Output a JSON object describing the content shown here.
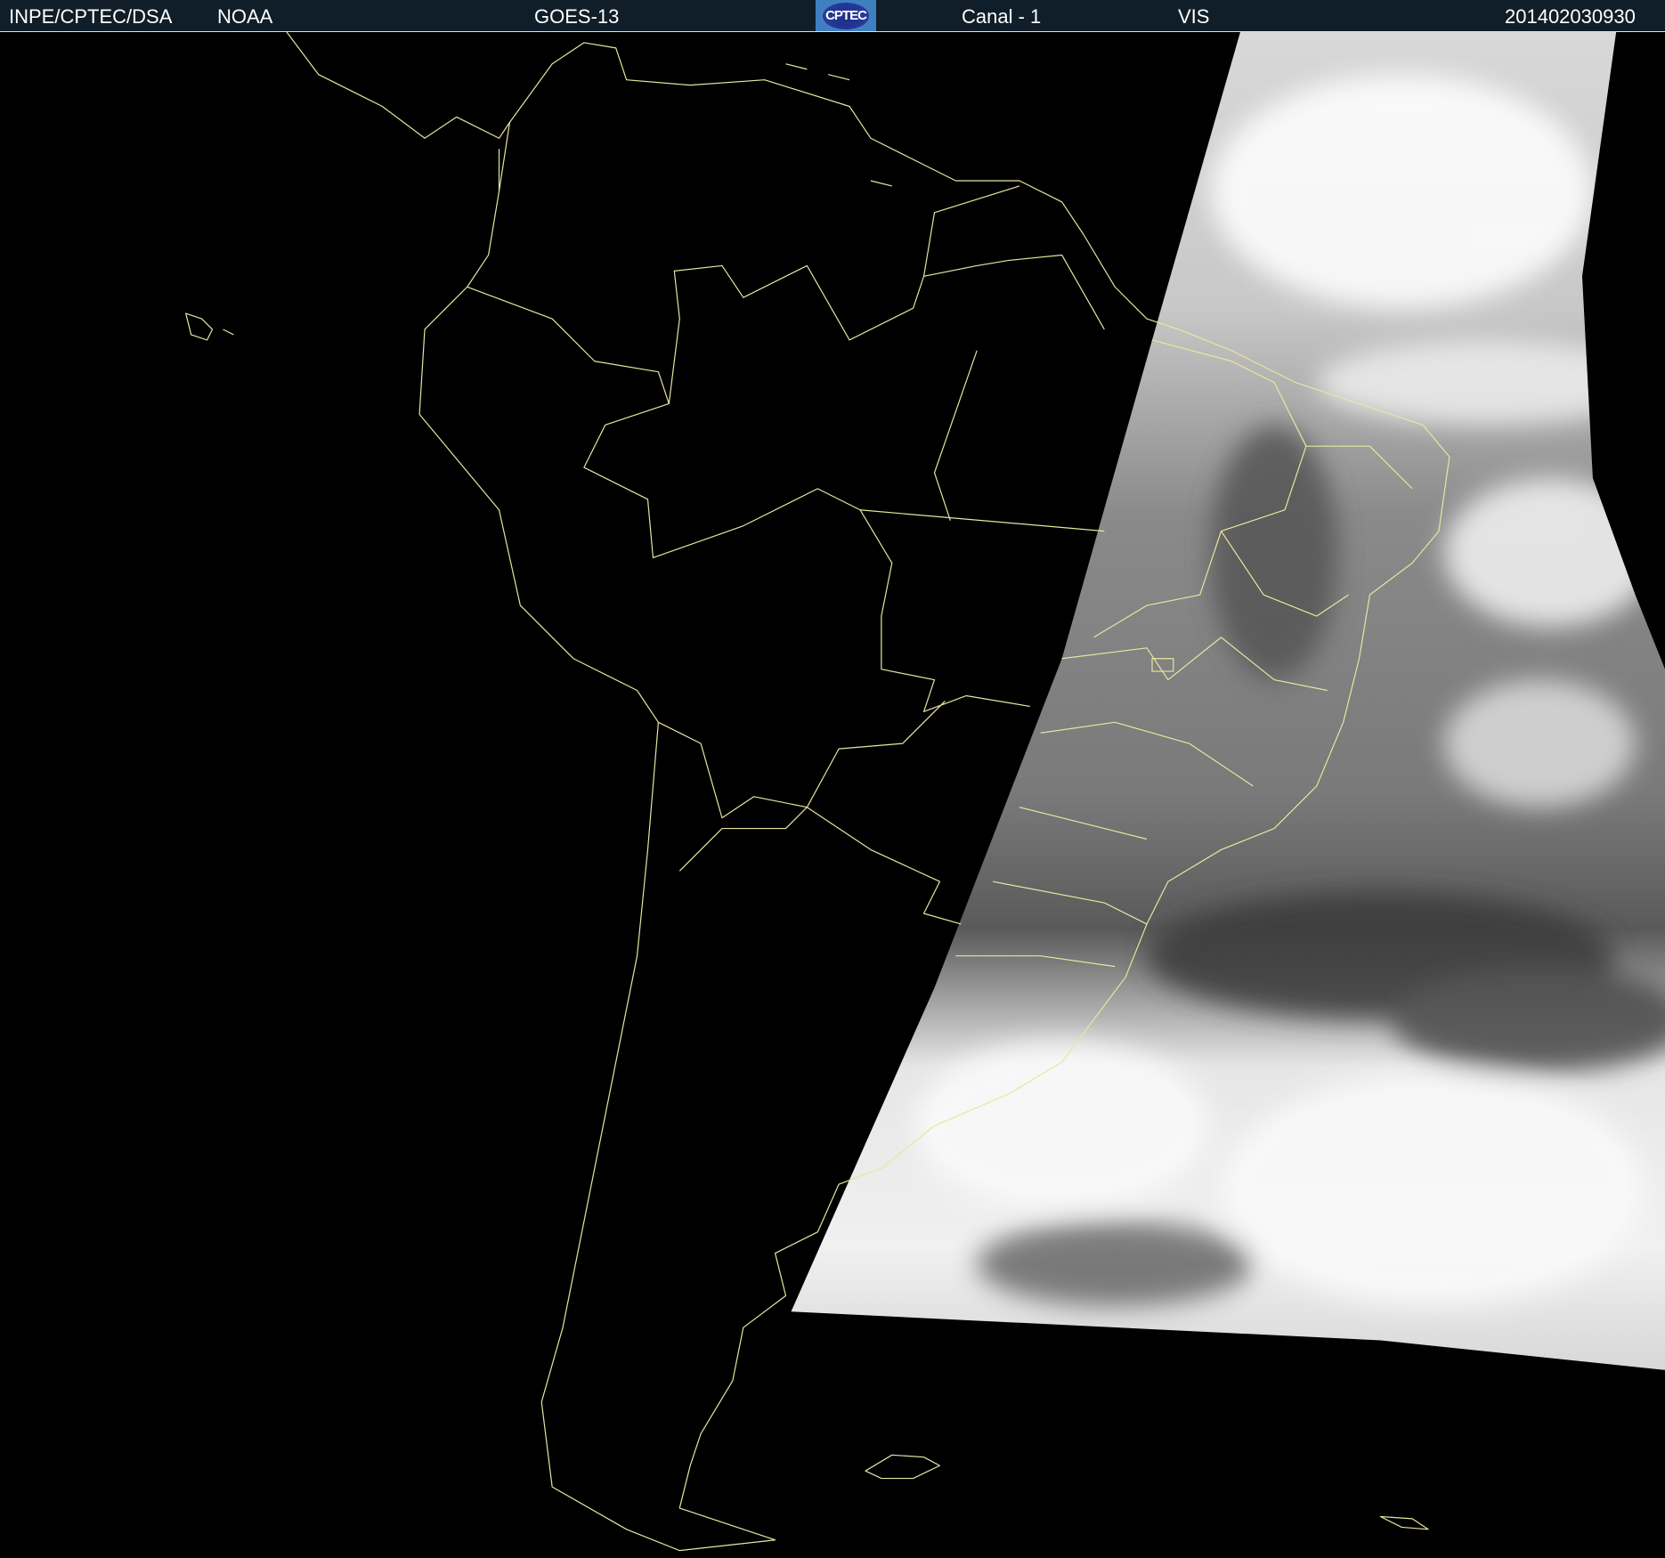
{
  "header": {
    "agency": "INPE/CPTEC/DSA",
    "source": "NOAA",
    "satellite": "GOES-13",
    "logo_text": "CPTEC",
    "channel": "Canal - 1",
    "band": "VIS",
    "timestamp": "201402030930"
  },
  "colors": {
    "header_bg": "#101e29",
    "coastline": "#e8e6a0",
    "background": "#000000"
  }
}
